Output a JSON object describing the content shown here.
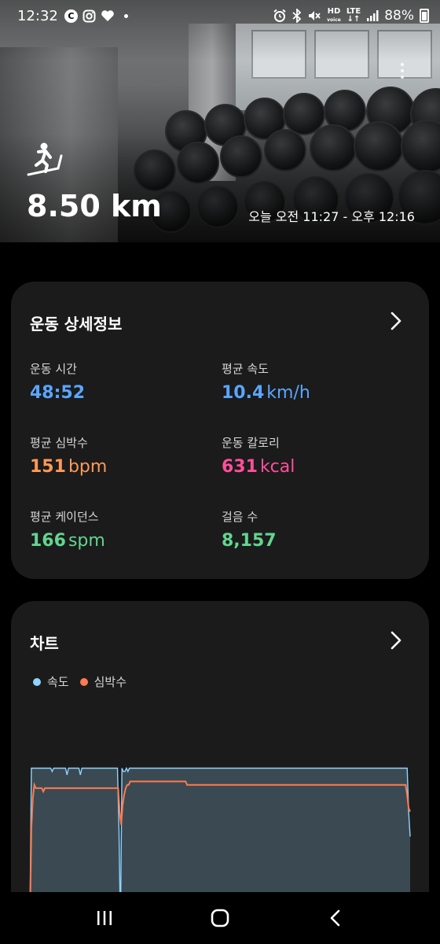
{
  "status_bar": {
    "time": "12:32",
    "battery": "88%",
    "icons": [
      "c-circle-icon",
      "instagram-icon",
      "heart-icon",
      "dot-icon",
      "alarm-icon",
      "bluetooth-icon",
      "mute-icon",
      "hd-voice-icon",
      "lte-icon",
      "signal-icon",
      "battery-icon"
    ],
    "hd_label": "HD",
    "lte_label": "LTE"
  },
  "hero": {
    "distance": "8.50 km",
    "time_range": "오늘 오전 11:27 - 오후 12:16",
    "activity_icon": "treadmill-runner-icon"
  },
  "details": {
    "title": "운동 상세정보",
    "metrics": [
      {
        "label": "운동 시간",
        "value": "48:52",
        "unit": "",
        "color": "#5aa6ff"
      },
      {
        "label": "평균 속도",
        "value": "10.4",
        "unit": "km/h",
        "color": "#5aa6ff"
      },
      {
        "label": "평균 심박수",
        "value": "151",
        "unit": "bpm",
        "color": "#ff9a57"
      },
      {
        "label": "운동 칼로리",
        "value": "631",
        "unit": "kcal",
        "color": "#ff4f9a"
      },
      {
        "label": "평균 케이던스",
        "value": "166",
        "unit": "spm",
        "color": "#63d58f"
      },
      {
        "label": "걸음 수",
        "value": "8,157",
        "unit": "",
        "color": "#63d58f"
      }
    ]
  },
  "chart_section": {
    "title": "차트",
    "legend": [
      {
        "name": "속도",
        "color": "#8fd3ff"
      },
      {
        "name": "심박수",
        "color": "#ff7a50"
      }
    ]
  },
  "chart_data": {
    "type": "line",
    "title": "",
    "series": [
      {
        "name": "속도",
        "values": [
          2,
          96,
          96,
          96,
          96,
          96,
          96,
          96,
          96,
          96,
          96,
          96,
          96,
          96,
          96,
          94,
          96,
          96,
          96,
          96,
          96,
          96,
          96,
          96,
          96,
          92,
          96,
          96,
          96,
          96,
          96,
          96,
          96,
          96,
          92,
          96,
          96,
          96,
          96,
          96,
          96,
          96,
          96,
          96,
          96,
          96,
          96,
          96,
          96,
          96,
          96,
          96,
          96,
          96,
          96,
          96,
          96,
          96,
          96,
          96,
          60,
          0,
          96,
          94,
          94,
          96,
          94,
          96,
          96,
          96,
          96,
          96,
          96,
          96,
          96,
          96,
          96,
          96,
          96,
          96,
          96,
          96,
          96,
          96,
          96,
          96,
          96,
          96,
          96,
          96,
          96,
          96,
          96,
          96,
          96,
          96,
          96,
          96,
          96,
          96,
          96,
          96,
          96,
          96,
          96,
          96,
          96,
          96,
          96,
          96,
          96,
          96,
          96,
          96,
          96,
          96,
          96,
          96,
          96,
          96,
          96,
          96,
          96,
          96,
          96,
          96,
          96,
          96,
          96,
          96,
          96,
          96,
          96,
          96,
          96,
          96,
          96,
          96,
          96,
          96,
          96,
          96,
          96,
          96,
          96,
          96,
          96,
          96,
          96,
          96,
          96,
          96,
          96,
          96,
          96,
          96,
          96,
          96,
          96,
          96,
          96,
          96,
          96,
          96,
          96,
          96,
          96,
          96,
          96,
          96,
          96,
          96,
          96,
          96,
          96,
          96,
          96,
          96,
          96,
          96,
          96,
          96,
          96,
          96,
          96,
          96,
          96,
          96,
          96,
          96,
          96,
          96,
          96,
          96,
          96,
          96,
          96,
          96,
          96,
          96,
          96,
          96,
          96,
          96,
          96,
          96,
          96,
          96,
          96,
          96,
          96,
          96,
          96,
          96,
          96,
          96,
          96,
          96,
          96,
          96,
          96,
          96,
          96,
          96,
          96,
          96,
          96,
          96,
          96,
          96,
          96,
          96,
          96,
          96,
          96,
          96,
          96,
          96,
          96,
          96,
          96,
          96,
          96,
          96,
          96,
          96,
          96,
          96,
          96,
          96,
          96,
          96,
          96,
          96,
          96,
          70,
          55
        ]
      },
      {
        "name": "심박수",
        "values": [
          0,
          60,
          78,
          86,
          84,
          84,
          84,
          84,
          84,
          82,
          84,
          84,
          84,
          84,
          84,
          84,
          84,
          84,
          84,
          84,
          84,
          84,
          84,
          84,
          84,
          84,
          84,
          84,
          84,
          84,
          84,
          84,
          84,
          84,
          84,
          84,
          84,
          84,
          84,
          84,
          84,
          84,
          84,
          84,
          84,
          84,
          84,
          84,
          84,
          84,
          84,
          84,
          84,
          84,
          84,
          84,
          84,
          84,
          84,
          84,
          70,
          62,
          74,
          80,
          84,
          86,
          86,
          88,
          88,
          88,
          88,
          88,
          88,
          88,
          88,
          88,
          88,
          88,
          88,
          88,
          88,
          88,
          88,
          88,
          88,
          88,
          88,
          88,
          88,
          88,
          88,
          88,
          88,
          88,
          88,
          88,
          88,
          88,
          88,
          88,
          88,
          88,
          88,
          88,
          88,
          86,
          86,
          86,
          86,
          86,
          86,
          86,
          86,
          86,
          86,
          86,
          86,
          86,
          86,
          86,
          86,
          86,
          86,
          86,
          86,
          86,
          86,
          86,
          86,
          86,
          86,
          86,
          86,
          86,
          86,
          86,
          86,
          86,
          86,
          86,
          86,
          86,
          86,
          86,
          86,
          86,
          86,
          86,
          86,
          86,
          86,
          86,
          86,
          86,
          86,
          86,
          86,
          86,
          86,
          86,
          86,
          86,
          86,
          86,
          86,
          86,
          86,
          86,
          86,
          86,
          86,
          86,
          86,
          86,
          86,
          86,
          86,
          86,
          86,
          86,
          86,
          86,
          86,
          86,
          86,
          86,
          86,
          86,
          86,
          86,
          86,
          86,
          86,
          86,
          86,
          86,
          86,
          86,
          86,
          86,
          86,
          86,
          86,
          86,
          86,
          86,
          86,
          86,
          86,
          86,
          86,
          86,
          86,
          86,
          86,
          86,
          86,
          86,
          86,
          86,
          86,
          86,
          86,
          86,
          86,
          86,
          86,
          86,
          86,
          86,
          86,
          86,
          86,
          86,
          86,
          86,
          86,
          86,
          86,
          86,
          86,
          86,
          86,
          86,
          86,
          86,
          86,
          86,
          86,
          86,
          86,
          86,
          80,
          72,
          70
        ]
      }
    ],
    "ylim": [
      0,
      100
    ],
    "grid": false
  },
  "nav": {
    "items": [
      "recent-apps-icon",
      "home-icon",
      "back-icon"
    ]
  }
}
